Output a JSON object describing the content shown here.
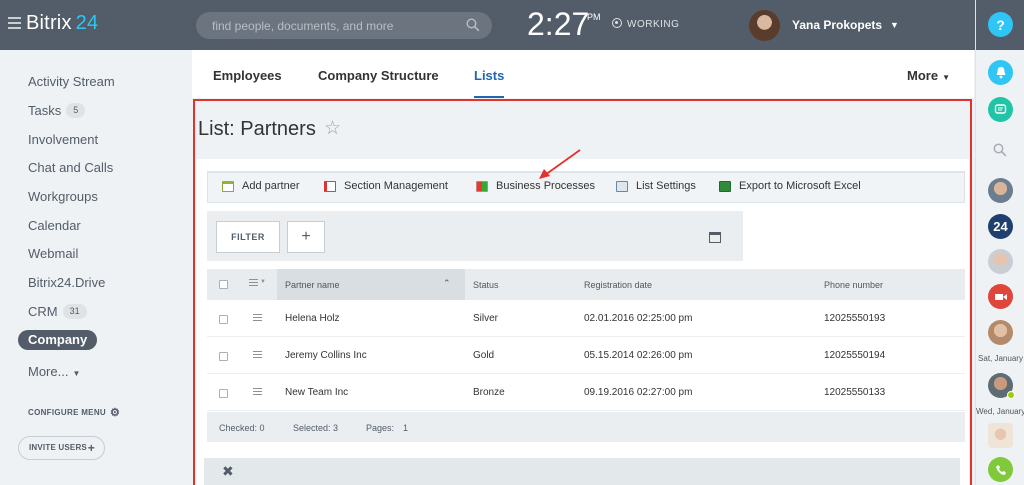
{
  "header": {
    "logo_text": "Bitrix",
    "logo_num": "24",
    "search_placeholder": "find people, documents, and more",
    "time": "2:27",
    "ampm": "PM",
    "status": "WORKING",
    "user_name": "Yana Prokopets"
  },
  "sidebar": {
    "items": [
      {
        "label": "Activity Stream"
      },
      {
        "label": "Tasks",
        "count": "5"
      },
      {
        "label": "Involvement"
      },
      {
        "label": "Chat and Calls"
      },
      {
        "label": "Workgroups"
      },
      {
        "label": "Calendar"
      },
      {
        "label": "Webmail"
      },
      {
        "label": "Bitrix24.Drive"
      },
      {
        "label": "CRM",
        "count": "31"
      },
      {
        "label": "Company"
      },
      {
        "label": "More..."
      }
    ],
    "configure_label": "CONFIGURE MENU",
    "invite_label": "INVITE USERS"
  },
  "tabs": {
    "items": [
      "Employees",
      "Company Structure",
      "Lists"
    ],
    "more": "More"
  },
  "page": {
    "title": "List: Partners"
  },
  "toolbar": {
    "items": [
      "Add partner",
      "Section Management",
      "Business Processes",
      "List Settings",
      "Export to Microsoft Excel"
    ]
  },
  "filter": {
    "filter_label": "FILTER",
    "add_label": "+"
  },
  "grid": {
    "columns": [
      "Partner name",
      "Status",
      "Registration date",
      "Phone number"
    ],
    "rows": [
      [
        "Helena Holz",
        "Silver",
        "02.01.2016 02:25:00 pm",
        "12025550193"
      ],
      [
        "Jeremy Collins Inc",
        "Gold",
        "05.15.2014 02:26:00 pm",
        "12025550194"
      ],
      [
        "New Team Inc",
        "Bronze",
        "09.19.2016 02:27:00 pm",
        "12025550133"
      ]
    ],
    "footer": {
      "checked": "Checked: 0",
      "selected": "Selected: 3",
      "pages_label": "Pages:",
      "pages_value": "1"
    }
  },
  "rightbar": {
    "help": "?",
    "b24": "24",
    "label_sat": "Sat, January",
    "label_wed": "Wed, January"
  },
  "colors": {
    "accent": "#2067b0",
    "highlight": "#e3322c",
    "topbar": "#535c69"
  }
}
